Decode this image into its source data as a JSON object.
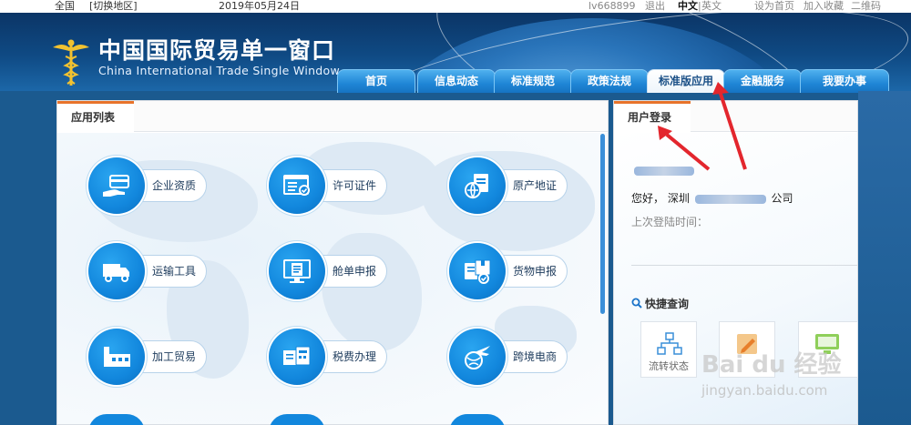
{
  "topbar": {
    "region": "全国",
    "switch_region": "[切换地区]",
    "date": "2019年05月24日",
    "user": "lv668899",
    "logout": "退出",
    "lang_cn": "中文",
    "lang_sep": "|",
    "lang_en": "英文",
    "set_home": "设为首页",
    "add_fav": "加入收藏",
    "qrcode": "二维码"
  },
  "brand": {
    "title_cn": "中国国际贸易单一窗口",
    "title_en": "China International Trade Single  Window"
  },
  "nav": {
    "tabs": [
      {
        "label": "首页"
      },
      {
        "label": "信息动态"
      },
      {
        "label": "标准规范"
      },
      {
        "label": "政策法规"
      },
      {
        "label": "标准版应用",
        "active": true
      },
      {
        "label": "金融服务"
      },
      {
        "label": "我要办事"
      }
    ]
  },
  "apps": {
    "title": "应用列表",
    "items": [
      {
        "label": "企业资质",
        "icon": "card-hand-icon"
      },
      {
        "label": "许可证件",
        "icon": "certificate-icon"
      },
      {
        "label": "原产地证",
        "icon": "globe-document-icon"
      },
      {
        "label": "运输工具",
        "icon": "truck-icon"
      },
      {
        "label": "舱单申报",
        "icon": "monitor-document-icon"
      },
      {
        "label": "货物申报",
        "icon": "box-document-icon"
      },
      {
        "label": "加工贸易",
        "icon": "factory-icon"
      },
      {
        "label": "税费办理",
        "icon": "tax-receipt-icon"
      },
      {
        "label": "跨境电商",
        "icon": "airplane-globe-icon"
      }
    ]
  },
  "login": {
    "title": "用户登录",
    "greeting": "您好，  深圳",
    "company_suffix": "公司",
    "last_login_label": "上次登陆时间：",
    "last_login_value": ""
  },
  "quick": {
    "title": "快捷查询",
    "items": [
      {
        "label": "流转状态"
      }
    ]
  },
  "watermark": {
    "brand": "Bai du 经验",
    "url": "jingyan.baidu.com"
  },
  "colors": {
    "accent_orange": "#e8732a",
    "nav_blue": "#1f86d6",
    "icon_blue": "#1287dd",
    "arrow_red": "#e3262d"
  }
}
